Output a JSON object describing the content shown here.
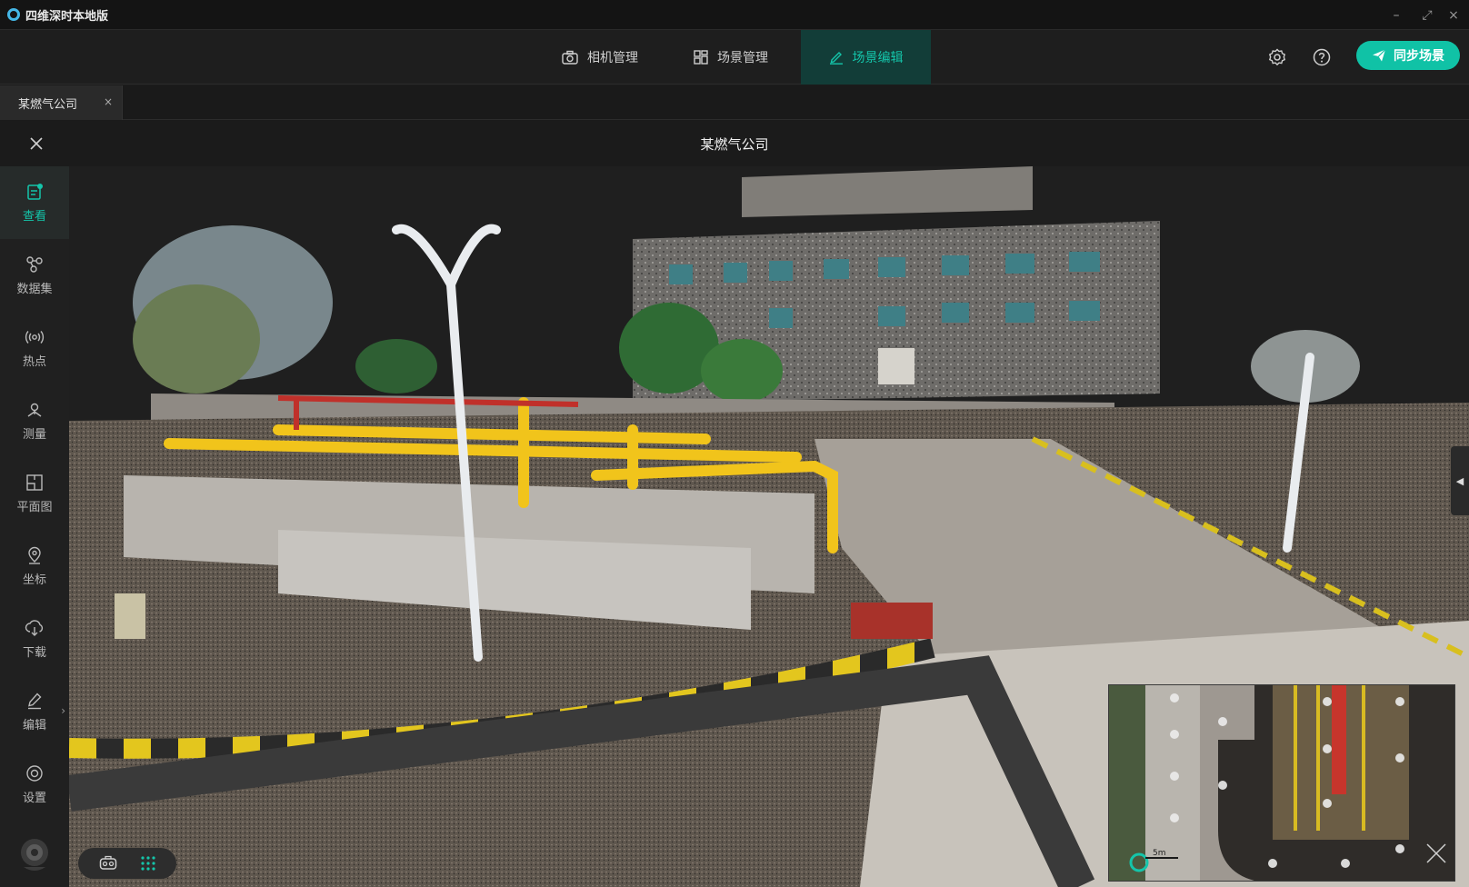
{
  "app": {
    "title": "四维深时本地版"
  },
  "window_controls": {
    "minimize": "–",
    "maximize": "⤢",
    "close": "×"
  },
  "nav": {
    "tabs": [
      {
        "label": "相机管理",
        "icon": "camera-icon",
        "active": false
      },
      {
        "label": "场景管理",
        "icon": "scene-grid-icon",
        "active": false
      },
      {
        "label": "场景编辑",
        "icon": "edit-pen-icon",
        "active": true
      }
    ],
    "sync_label": "同步场景",
    "accent": "#10c2a6"
  },
  "doc_tab": {
    "label": "某燃气公司",
    "close": "×"
  },
  "scene": {
    "title": "某燃气公司"
  },
  "sidebar": {
    "items": [
      {
        "label": "查看",
        "icon": "view-doc-icon",
        "active": true
      },
      {
        "label": "数据集",
        "icon": "dataset-icon",
        "active": false
      },
      {
        "label": "热点",
        "icon": "hotspot-icon",
        "active": false
      },
      {
        "label": "测量",
        "icon": "measure-icon",
        "active": false
      },
      {
        "label": "平面图",
        "icon": "floorplan-icon",
        "active": false
      },
      {
        "label": "坐标",
        "icon": "location-pin-icon",
        "active": false
      },
      {
        "label": "下载",
        "icon": "cloud-download-icon",
        "active": false
      },
      {
        "label": "编辑",
        "icon": "edit-icon",
        "active": false,
        "submenu": "›"
      },
      {
        "label": "设置",
        "icon": "settings-icon",
        "active": false
      }
    ]
  },
  "viewport": {
    "side_toggle": "◀"
  },
  "minimap": {
    "scale_label": "5m"
  }
}
